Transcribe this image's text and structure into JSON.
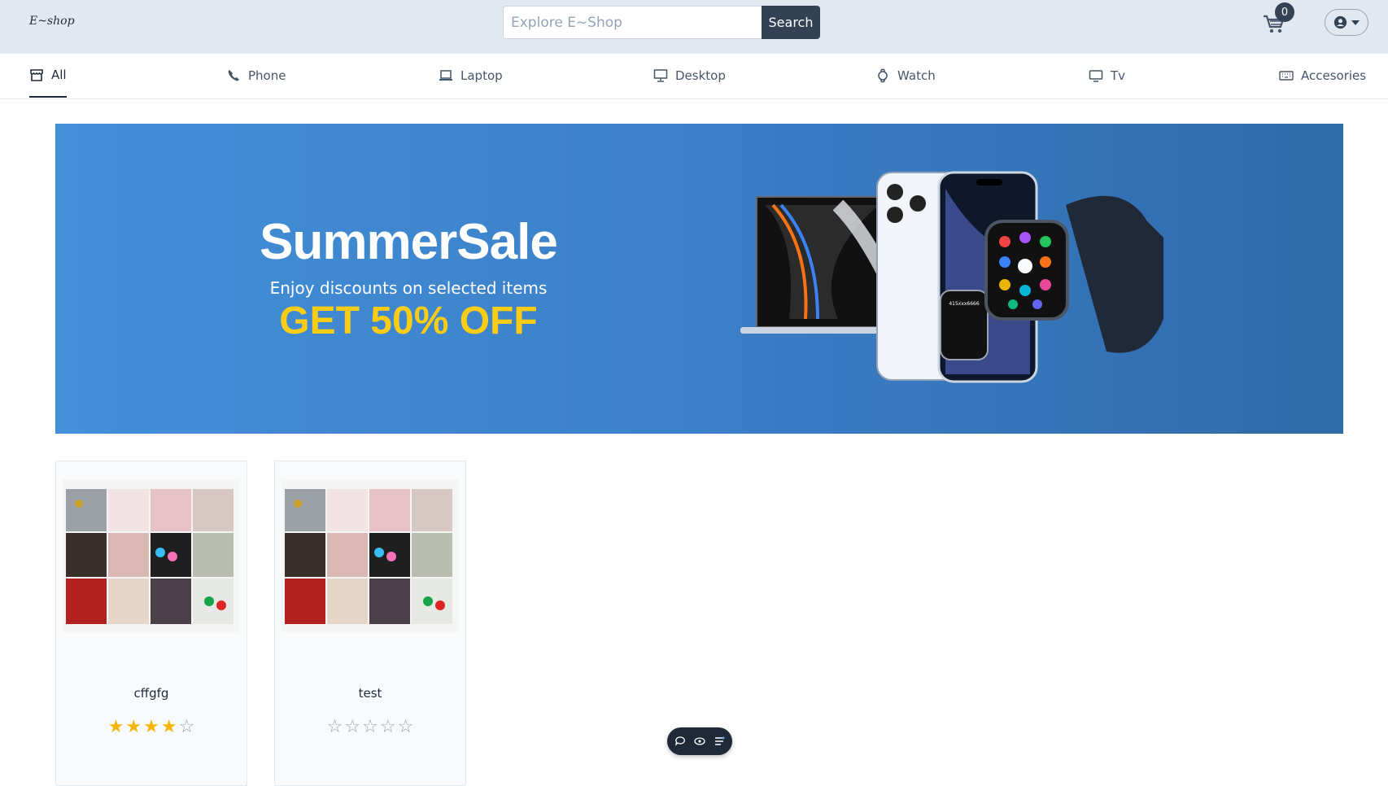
{
  "app": {
    "logo_text": "E~shop"
  },
  "search": {
    "placeholder": "Explore E~Shop",
    "button_label": "Search"
  },
  "cart": {
    "count": "0"
  },
  "categories": [
    {
      "label": "All",
      "icon": "storefront-icon",
      "active": true
    },
    {
      "label": "Phone",
      "icon": "phone-icon",
      "active": false
    },
    {
      "label": "Laptop",
      "icon": "laptop-icon",
      "active": false
    },
    {
      "label": "Desktop",
      "icon": "desktop-icon",
      "active": false
    },
    {
      "label": "Watch",
      "icon": "watch-icon",
      "active": false
    },
    {
      "label": "Tv",
      "icon": "tv-icon",
      "active": false
    },
    {
      "label": "Accesories",
      "icon": "keyboard-icon",
      "active": false
    }
  ],
  "banner": {
    "title": "SummerSale",
    "subtitle": "Enjoy discounts on selected items",
    "offer": "GET 50% OFF",
    "watch_screen_text": "415xxx6666"
  },
  "products": [
    {
      "name": "cffgfg",
      "rating": 4
    },
    {
      "name": "test",
      "rating": 0
    }
  ],
  "colors": {
    "topbar": "#e2e8f0",
    "banner": "#3b82d0",
    "offer": "#facc15",
    "star": "#f5b50a"
  }
}
